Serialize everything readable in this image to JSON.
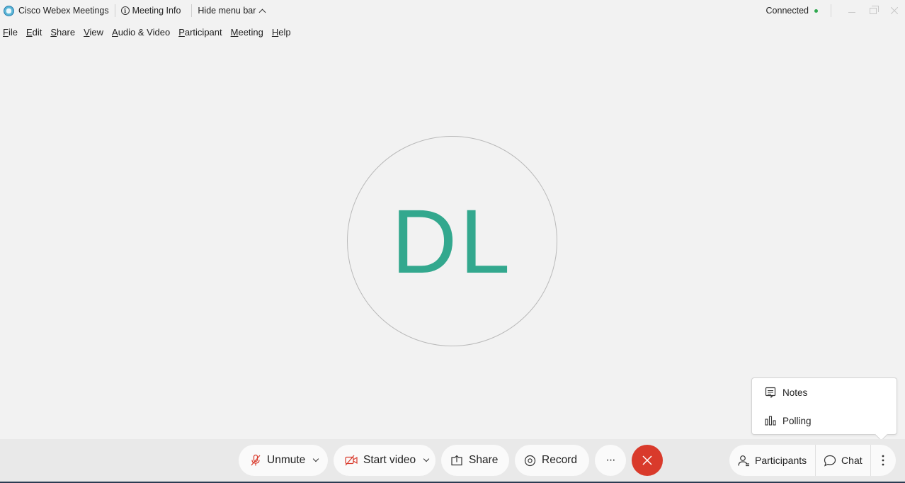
{
  "titlebar": {
    "app_name": "Cisco Webex Meetings",
    "meeting_info": "Meeting Info",
    "hide_menu": "Hide menu bar",
    "status": "Connected",
    "status_color": "#2fa84f"
  },
  "menubar": {
    "items": [
      {
        "label_u": "F",
        "label_rest": "ile"
      },
      {
        "label_u": "E",
        "label_rest": "dit"
      },
      {
        "label_u": "S",
        "label_rest": "hare"
      },
      {
        "label_u": "V",
        "label_rest": "iew"
      },
      {
        "label_u": "A",
        "label_rest": "udio & Video"
      },
      {
        "label_u": "P",
        "label_rest": "articipant"
      },
      {
        "label_u": "M",
        "label_rest": "eeting"
      },
      {
        "label_u": "H",
        "label_rest": "elp"
      }
    ]
  },
  "stage": {
    "avatar_initials": "DL",
    "avatar_color": "#33a88e"
  },
  "popup": {
    "items": [
      {
        "label": "Notes",
        "icon": "notes-icon"
      },
      {
        "label": "Polling",
        "icon": "polling-icon"
      }
    ]
  },
  "controls": {
    "unmute": "Unmute",
    "start_video": "Start video",
    "share": "Share",
    "record": "Record",
    "more": "···",
    "end_color": "#d93a2b"
  },
  "right_panel": {
    "participants": "Participants",
    "chat": "Chat"
  }
}
